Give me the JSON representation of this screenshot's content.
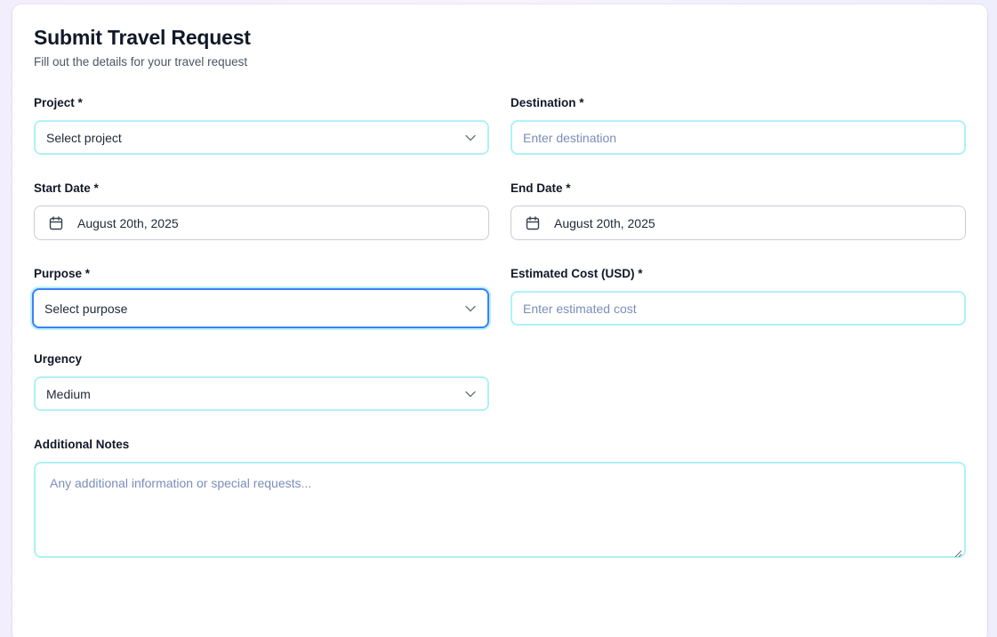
{
  "header": {
    "title": "Submit Travel Request",
    "subtitle": "Fill out the details for your travel request"
  },
  "form": {
    "project": {
      "label": "Project *",
      "value": "Select project"
    },
    "destination": {
      "label": "Destination *",
      "placeholder": "Enter destination"
    },
    "start_date": {
      "label": "Start Date *",
      "value": "August 20th, 2025"
    },
    "end_date": {
      "label": "End Date *",
      "value": "August 20th, 2025"
    },
    "purpose": {
      "label": "Purpose *",
      "value": "Select purpose"
    },
    "estimated_cost": {
      "label": "Estimated Cost (USD) *",
      "placeholder": "Enter estimated cost"
    },
    "urgency": {
      "label": "Urgency",
      "value": "Medium"
    },
    "notes": {
      "label": "Additional Notes",
      "placeholder": "Any additional information or special requests..."
    }
  },
  "colors": {
    "field_border": "#aef2f6",
    "focus_border": "#3b82f6",
    "placeholder": "#7b8db8"
  },
  "icons": {
    "select": "chevron-down-icon",
    "date": "calendar-icon"
  }
}
